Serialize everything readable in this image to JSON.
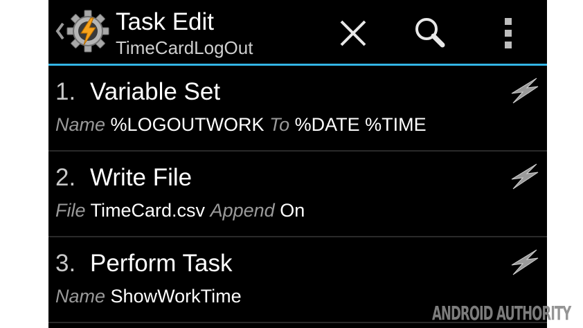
{
  "action_bar": {
    "title": "Task Edit",
    "subtitle": "TimeCardLogOut",
    "app_icon": "tasker-gear-bolt-icon",
    "actions": [
      "close-icon",
      "search-icon",
      "overflow-menu-icon"
    ],
    "accent_color": "#33b5e5"
  },
  "actions": [
    {
      "number": "1.",
      "name": "Variable Set",
      "icon": "lightning-bolt-icon",
      "params": [
        {
          "label": "Name",
          "value": "%LOGOUTWORK"
        },
        {
          "label": "To",
          "value": "%DATE %TIME"
        }
      ]
    },
    {
      "number": "2.",
      "name": "Write File",
      "icon": "lightning-bolt-icon",
      "params": [
        {
          "label": "File",
          "value": "TimeCard.csv"
        },
        {
          "label": "Append",
          "value": "On"
        }
      ]
    },
    {
      "number": "3.",
      "name": "Perform Task",
      "icon": "lightning-bolt-icon",
      "params": [
        {
          "label": "Name",
          "value": "ShowWorkTime"
        }
      ]
    }
  ],
  "watermark": "ANDROID AUTHORITY"
}
